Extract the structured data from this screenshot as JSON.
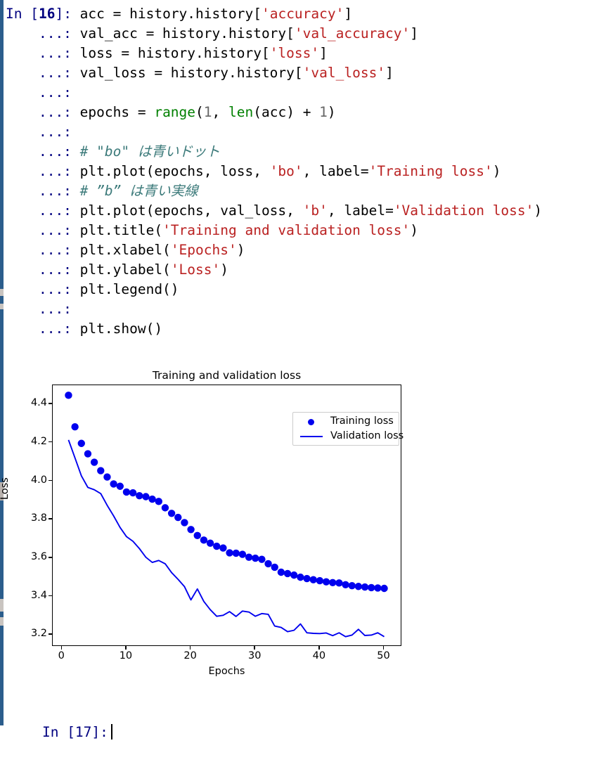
{
  "console": {
    "input_prompt": "In [16]:",
    "continuation_prompt": "...:",
    "next_prompt": "In [17]:",
    "lines": [
      {
        "prompt": "In [16]:",
        "tokens": [
          {
            "t": "plain",
            "s": " acc = history.history["
          },
          {
            "t": "str",
            "s": "'accuracy'"
          },
          {
            "t": "plain",
            "s": "]"
          }
        ]
      },
      {
        "prompt": "...:",
        "tokens": [
          {
            "t": "plain",
            "s": " val_acc = history.history["
          },
          {
            "t": "str",
            "s": "'val_accuracy'"
          },
          {
            "t": "plain",
            "s": "]"
          }
        ]
      },
      {
        "prompt": "...:",
        "tokens": [
          {
            "t": "plain",
            "s": " loss = history.history["
          },
          {
            "t": "str",
            "s": "'loss'"
          },
          {
            "t": "plain",
            "s": "]"
          }
        ]
      },
      {
        "prompt": "...:",
        "tokens": [
          {
            "t": "plain",
            "s": " val_loss = history.history["
          },
          {
            "t": "str",
            "s": "'val_loss'"
          },
          {
            "t": "plain",
            "s": "]"
          }
        ]
      },
      {
        "prompt": "...:",
        "tokens": []
      },
      {
        "prompt": "...:",
        "tokens": [
          {
            "t": "plain",
            "s": " epochs = "
          },
          {
            "t": "builtin",
            "s": "range"
          },
          {
            "t": "plain",
            "s": "("
          },
          {
            "t": "num",
            "s": "1"
          },
          {
            "t": "plain",
            "s": ", "
          },
          {
            "t": "builtin",
            "s": "len"
          },
          {
            "t": "plain",
            "s": "(acc) + "
          },
          {
            "t": "num",
            "s": "1"
          },
          {
            "t": "plain",
            "s": ")"
          }
        ]
      },
      {
        "prompt": "...:",
        "tokens": []
      },
      {
        "prompt": "...:",
        "tokens": [
          {
            "t": "comment",
            "s": " # \"bo\" は青いドット"
          }
        ]
      },
      {
        "prompt": "...:",
        "tokens": [
          {
            "t": "plain",
            "s": " plt.plot(epochs, loss, "
          },
          {
            "t": "str",
            "s": "'bo'"
          },
          {
            "t": "plain",
            "s": ", label="
          },
          {
            "t": "str",
            "s": "'Training loss'"
          },
          {
            "t": "plain",
            "s": ")"
          }
        ]
      },
      {
        "prompt": "...:",
        "tokens": [
          {
            "t": "comment",
            "s": " # ”b” は青い実線"
          }
        ]
      },
      {
        "prompt": "...:",
        "tokens": [
          {
            "t": "plain",
            "s": " plt.plot(epochs, val_loss, "
          },
          {
            "t": "str",
            "s": "'b'"
          },
          {
            "t": "plain",
            "s": ", label="
          },
          {
            "t": "str",
            "s": "'Validation loss'"
          },
          {
            "t": "plain",
            "s": ")"
          }
        ]
      },
      {
        "prompt": "...:",
        "tokens": [
          {
            "t": "plain",
            "s": " plt.title("
          },
          {
            "t": "str",
            "s": "'Training and validation loss'"
          },
          {
            "t": "plain",
            "s": ")"
          }
        ]
      },
      {
        "prompt": "...:",
        "tokens": [
          {
            "t": "plain",
            "s": " plt.xlabel("
          },
          {
            "t": "str",
            "s": "'Epochs'"
          },
          {
            "t": "plain",
            "s": ")"
          }
        ]
      },
      {
        "prompt": "...:",
        "tokens": [
          {
            "t": "plain",
            "s": " plt.ylabel("
          },
          {
            "t": "str",
            "s": "'Loss'"
          },
          {
            "t": "plain",
            "s": ")"
          }
        ]
      },
      {
        "prompt": "...:",
        "tokens": [
          {
            "t": "plain",
            "s": " plt.legend()"
          }
        ]
      },
      {
        "prompt": "...:",
        "tokens": []
      },
      {
        "prompt": "...:",
        "tokens": [
          {
            "t": "plain",
            "s": " plt.show()"
          }
        ]
      }
    ]
  },
  "colors": {
    "prompt": "#000080",
    "string": "#ba2121",
    "builtin": "#008000",
    "number": "#666666",
    "comment": "#3d7b7b",
    "series": "#0000ee",
    "window_edge": "#2b5d8c"
  },
  "chart_data": {
    "type": "scatter",
    "title": "Training and validation loss",
    "xlabel": "Epochs",
    "ylabel": "Loss",
    "xlim": [
      -1.45,
      52.45
    ],
    "ylim": [
      3.1505,
      4.4995
    ],
    "xticks": [
      0,
      10,
      20,
      30,
      40,
      50
    ],
    "yticks": [
      3.2,
      3.4,
      3.6,
      3.8,
      4.0,
      4.2,
      4.4
    ],
    "grid": false,
    "legend_position": "upper right",
    "legend": [
      "Training loss",
      "Validation loss"
    ],
    "x": [
      1,
      2,
      3,
      4,
      5,
      6,
      7,
      8,
      9,
      10,
      11,
      12,
      13,
      14,
      15,
      16,
      17,
      18,
      19,
      20,
      21,
      22,
      23,
      24,
      25,
      26,
      27,
      28,
      29,
      30,
      31,
      32,
      33,
      34,
      35,
      36,
      37,
      38,
      39,
      40,
      41,
      42,
      43,
      44,
      45,
      46,
      47,
      48,
      49,
      50
    ],
    "series": [
      {
        "name": "Training loss",
        "style": "markers",
        "marker": "circle",
        "color": "#0000ee",
        "values": [
          4.447,
          4.283,
          4.197,
          4.143,
          4.099,
          4.055,
          4.022,
          3.986,
          3.974,
          3.944,
          3.94,
          3.925,
          3.92,
          3.907,
          3.895,
          3.862,
          3.833,
          3.812,
          3.785,
          3.749,
          3.718,
          3.694,
          3.678,
          3.662,
          3.653,
          3.628,
          3.626,
          3.62,
          3.605,
          3.6,
          3.594,
          3.571,
          3.553,
          3.527,
          3.52,
          3.512,
          3.501,
          3.494,
          3.488,
          3.483,
          3.477,
          3.473,
          3.471,
          3.462,
          3.457,
          3.453,
          3.45,
          3.447,
          3.445,
          3.443
        ]
      },
      {
        "name": "Validation loss",
        "style": "line",
        "color": "#0000ee",
        "values": [
          4.215,
          4.122,
          4.028,
          3.968,
          3.956,
          3.936,
          3.875,
          3.82,
          3.76,
          3.712,
          3.688,
          3.65,
          3.605,
          3.578,
          3.588,
          3.571,
          3.525,
          3.49,
          3.452,
          3.383,
          3.44,
          3.375,
          3.332,
          3.298,
          3.303,
          3.322,
          3.297,
          3.325,
          3.32,
          3.298,
          3.312,
          3.308,
          3.247,
          3.24,
          3.218,
          3.225,
          3.258,
          3.212,
          3.209,
          3.208,
          3.211,
          3.197,
          3.212,
          3.192,
          3.2,
          3.23,
          3.198,
          3.2,
          3.212,
          3.192
        ]
      }
    ]
  }
}
